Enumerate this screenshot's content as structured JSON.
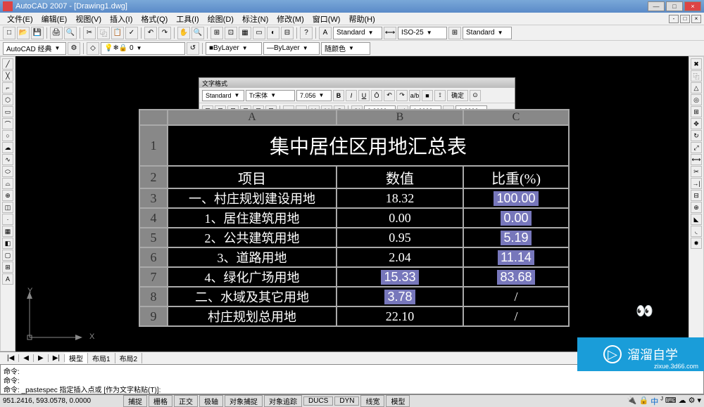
{
  "app": {
    "title": "AutoCAD 2007 - [Drawing1.dwg]"
  },
  "menu": [
    "文件(E)",
    "编辑(E)",
    "视图(V)",
    "插入(I)",
    "格式(Q)",
    "工具(I)",
    "绘图(D)",
    "标注(N)",
    "修改(M)",
    "窗口(W)",
    "帮助(H)"
  ],
  "workspace_sel": "AutoCAD 经典",
  "toolbar2": {
    "style": "Standard",
    "dim": "ISO-25",
    "tstyle": "Standard",
    "layer_color": "ByLayer",
    "layer_lt": "ByLayer",
    "color_label": "随颜色"
  },
  "text_editor": {
    "title": "文字格式",
    "style": "Standard",
    "font": "宋体",
    "size": "7.056",
    "ok": "确定",
    "num1": "0.0000",
    "num2": "1.0000",
    "num3": "1.0000"
  },
  "chart_data": {
    "type": "table",
    "title": "集中居住区用地汇总表",
    "columns": [
      "A",
      "B",
      "C"
    ],
    "headers": [
      "项目",
      "数值",
      "比重(%)"
    ],
    "rows": [
      {
        "n": "1"
      },
      {
        "n": "2"
      },
      {
        "n": "3",
        "a": "一、村庄规划建设用地",
        "b": "18.32",
        "c": "100.00",
        "c_sel": true
      },
      {
        "n": "4",
        "a": "1、居住建筑用地",
        "b": "0.00",
        "c": "0.00",
        "c_sel": true
      },
      {
        "n": "5",
        "a": "2、公共建筑用地",
        "b": "0.95",
        "c": "5.19",
        "c_sel": true
      },
      {
        "n": "6",
        "a": "3、道路用地",
        "b": "2.04",
        "c": "11.14",
        "c_sel": true
      },
      {
        "n": "7",
        "a": "4、绿化广场用地",
        "b": "15.33",
        "b_sel": true,
        "c": "83.68",
        "c_sel": true
      },
      {
        "n": "8",
        "a": "二、水域及其它用地",
        "b": "3.78",
        "b_sel": true,
        "c": "/"
      },
      {
        "n": "9",
        "a": "村庄规划总用地",
        "b": "22.10",
        "c": "/"
      }
    ]
  },
  "ucs": {
    "x": "X",
    "y": "Y"
  },
  "tabs": [
    "模型",
    "布局1",
    "布局2"
  ],
  "cmd": {
    "l1": "命令:",
    "l2": "命令:",
    "l3": "命令: _pastespec 指定插入点或 [作为文字粘贴(T)]:"
  },
  "status": {
    "coords": "951.2416, 593.0578, 0.0000",
    "btns": [
      "捕捉",
      "栅格",
      "正交",
      "极轴",
      "对象捕捉",
      "对象追踪",
      "DUCS",
      "DYN",
      "线宽",
      "模型"
    ]
  },
  "watermark": {
    "brand": "溜溜自学",
    "url": "zixue.3d66.com"
  }
}
